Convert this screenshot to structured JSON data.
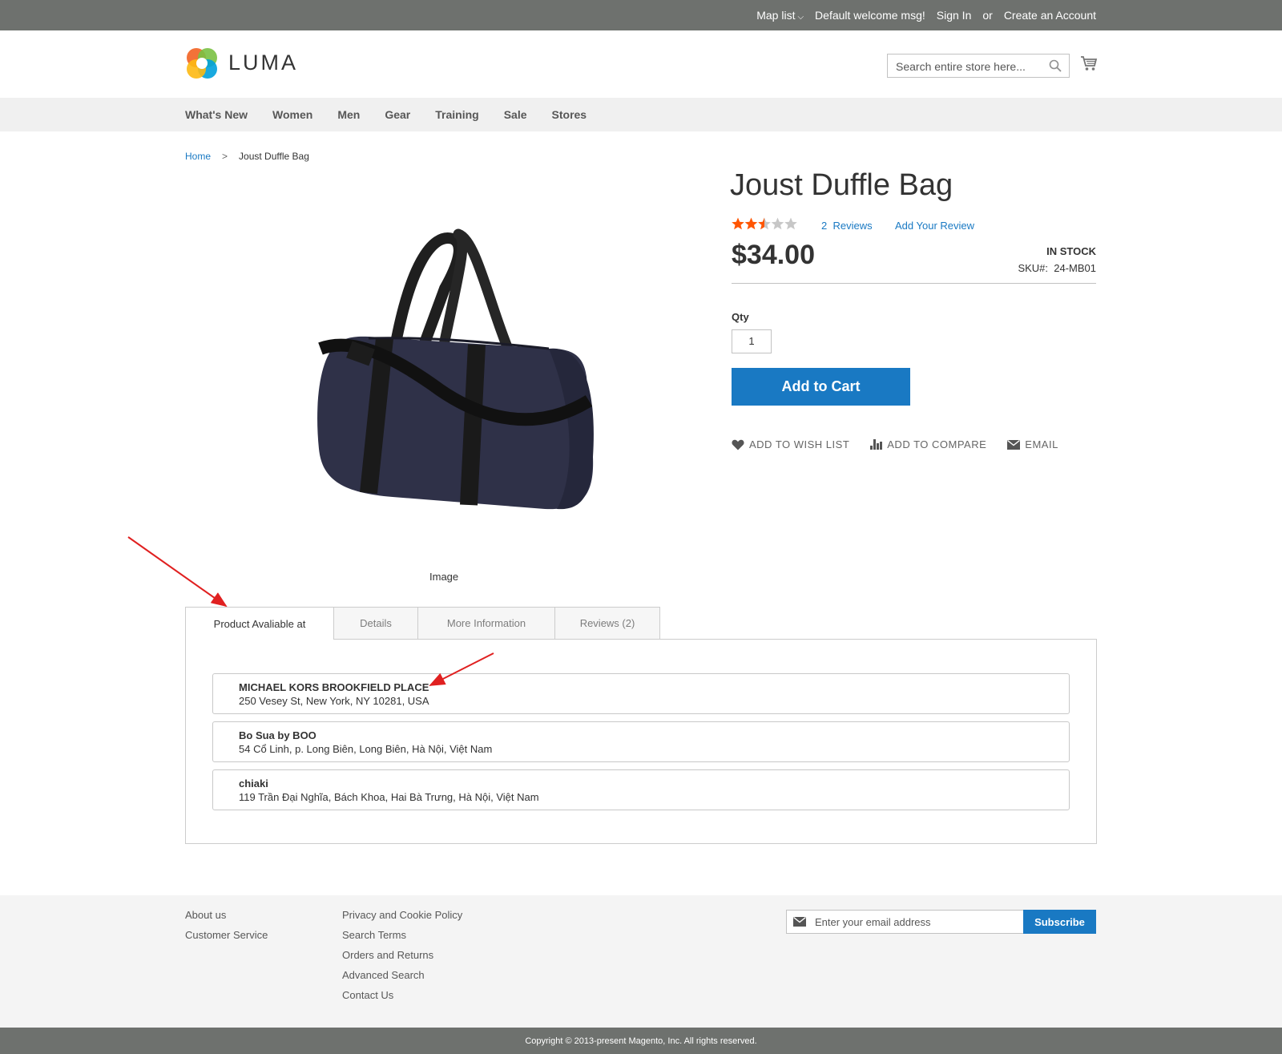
{
  "header_panel": {
    "map_list": "Map list",
    "welcome": "Default welcome msg!",
    "sign_in": "Sign In",
    "or": "or",
    "create_account": "Create an Account"
  },
  "logo": {
    "text": "LUMA"
  },
  "search": {
    "placeholder": "Search entire store here..."
  },
  "nav": {
    "items": [
      "What's New",
      "Women",
      "Men",
      "Gear",
      "Training",
      "Sale",
      "Stores"
    ]
  },
  "breadcrumb": {
    "home": "Home",
    "separator": ">",
    "current": "Joust Duffle Bag"
  },
  "product": {
    "image_caption": "Image",
    "title": "Joust Duffle Bag",
    "rating_stars": 2.5,
    "rating_max": 5,
    "reviews_label": "2  Reviews",
    "add_review": "Add Your Review",
    "price": "$34.00",
    "stock": "In stock",
    "sku": "SKU#:  24-MB01",
    "qty_label": "Qty",
    "qty_value": "1",
    "add_to_cart": "Add to Cart",
    "actions": {
      "wishlist": "Add to Wish List",
      "compare": "Add to Compare",
      "email": "Email"
    }
  },
  "tabs": [
    {
      "label": "Product Avaliable at"
    },
    {
      "label": "Details"
    },
    {
      "label": "More Information"
    },
    {
      "label": "Reviews (2)"
    }
  ],
  "stores": [
    {
      "name": "MICHAEL KORS BROOKFIELD PLACE",
      "address": "250 Vesey St, New York, NY 10281, USA"
    },
    {
      "name": "Bo Sua by BOO",
      "address": "54 Cổ Linh, p. Long Biên, Long Biên, Hà Nội, Việt Nam"
    },
    {
      "name": "chiaki",
      "address": "119 Trần Đại Nghĩa, Bách Khoa, Hai Bà Trưng, Hà Nội, Việt Nam"
    }
  ],
  "footer": {
    "col1": [
      "About us",
      "Customer Service"
    ],
    "col2": [
      "Privacy and Cookie Policy",
      "Search Terms",
      "Orders and Returns",
      "Advanced Search",
      "Contact Us"
    ],
    "newsletter_placeholder": "Enter your email address",
    "subscribe": "Subscribe",
    "copyright": "Copyright © 2013-present Magento, Inc. All rights reserved."
  },
  "colors": {
    "primary": "#1979c3",
    "top_bar": "#6e716e",
    "star_filled": "#ff5501",
    "star_empty": "#c7c7c7",
    "annotation_arrow": "#e02020"
  }
}
